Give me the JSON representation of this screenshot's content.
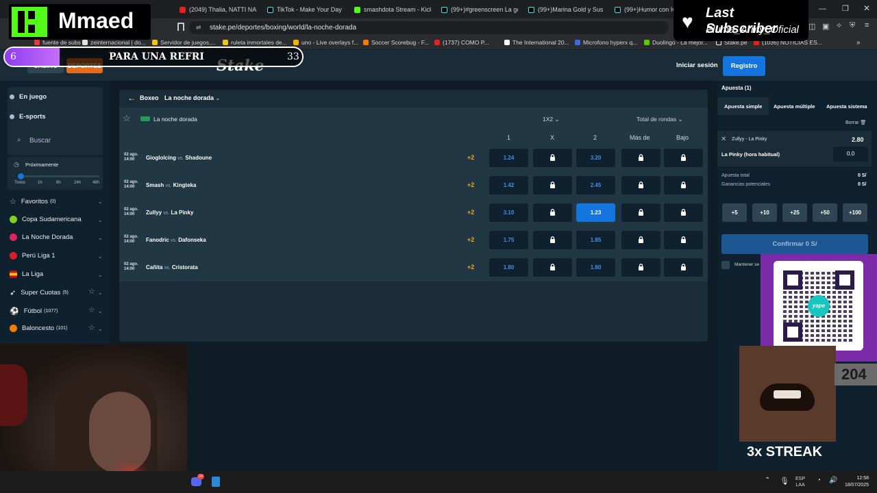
{
  "browser": {
    "tabs": [
      {
        "title": "(2049) Thalia, NATTI NATA",
        "color": "#e62117"
      },
      {
        "title": "TikTok - Make Your Day",
        "color": "#111111"
      },
      {
        "title": "smashdota Stream - Kick",
        "color": "#53fc18"
      },
      {
        "title": "(99+)#greenscreen La gen",
        "color": "#111111"
      },
      {
        "title": "(99+)Marina Gold y Sus H",
        "color": "#111111"
      },
      {
        "title": "(99+)Humor con Ivan",
        "color": "#111111"
      }
    ],
    "url": "stake.pe/deportes/boxing/world/la-noche-dorada",
    "bookmarks": [
      {
        "label": "fuente de subs",
        "color": "#e23b3b"
      },
      {
        "label": "zeinternacional | do...",
        "color": "#e2e2e2"
      },
      {
        "label": "Servidor de juegos,...",
        "color": "#bbbbbb"
      },
      {
        "label": "ruleta inmortales de...",
        "color": "#f5b400"
      },
      {
        "label": "uno - Live overlays f...",
        "color": "#f5b400"
      },
      {
        "label": "Soccer Scorebug - F...",
        "color": "#f57c00"
      },
      {
        "label": "(1737) COMO P...",
        "color": "#e62117"
      },
      {
        "label": "The International 20...",
        "color": "#ffffff"
      },
      {
        "label": "Microfono hyperx q...",
        "color": "#3b6edc"
      },
      {
        "label": "Duolingo - La mejor...",
        "color": "#58cc02"
      },
      {
        "label": "Stake.pe",
        "color": "#1a2c38"
      },
      {
        "label": "(1036) NOTICIAS ES...",
        "color": "#e62117"
      }
    ]
  },
  "overlay": {
    "channel_name": "Mmaed",
    "goal_count": "6",
    "goal_text": "PARA UNA REFRI",
    "goal_target": "33",
    "last_subscriber_title": "Last Subscriber",
    "last_subscriber_name": "Pluma_Army_Oficial",
    "qr_label": "yape",
    "streak_count": "204",
    "streak_label": "3x STREAK"
  },
  "stake": {
    "nav_casino": "CASINO",
    "nav_sports": "DEPORTES",
    "logo": "Stake",
    "login": "Iniciar sesión",
    "register": "Registro",
    "sidebar": {
      "live": "En juego",
      "esports": "E-sports",
      "search_placeholder": "Buscar",
      "upcoming": "Próximamente",
      "time_filters": [
        "Todos",
        "1h",
        "8h",
        "24h",
        "48h"
      ],
      "items": [
        {
          "label": "Favoritos",
          "count": "(0)",
          "color": "#7f94a3",
          "star": false
        },
        {
          "label": "Copa Sudamericana",
          "count": "",
          "color": "#7ed321",
          "star": false
        },
        {
          "label": "La Noche Dorada",
          "count": "",
          "color": "#e0245e",
          "star": false
        },
        {
          "label": "Perú Liga 1",
          "count": "",
          "color": "#d91e2a",
          "star": false
        },
        {
          "label": "La Liga",
          "count": "",
          "color": "#f6c000",
          "star": false
        },
        {
          "label": "Super Cuotas",
          "count": "(5)",
          "color": "#ffffff",
          "star": true
        },
        {
          "label": "Fútbol",
          "count": "(1077)",
          "color": "#ffffff",
          "star": true
        },
        {
          "label": "Baloncesto",
          "count": "(101)",
          "color": "#f57c00",
          "star": true
        }
      ]
    },
    "breadcrumb": {
      "sport": "Boxeo",
      "event": "La noche dorada"
    },
    "event_title": "La noche dorada",
    "market_selector": "1X2",
    "rounds_selector": "Total de rondas",
    "columns": [
      "1",
      "X",
      "2",
      "Más de",
      "Bajo"
    ],
    "matches": [
      {
        "date": "02 ago.",
        "time": "14:00",
        "home": "Gioglolcing",
        "away": "Shadoune",
        "more": "+2",
        "odd1": "1.24",
        "odd2": "3.20",
        "selected": false
      },
      {
        "date": "02 ago.",
        "time": "14:00",
        "home": "Smash",
        "away": "Kingteka",
        "more": "+2",
        "odd1": "1.42",
        "odd2": "2.45",
        "selected": false
      },
      {
        "date": "02 ago.",
        "time": "14:00",
        "home": "Zullyy",
        "away": "La Pinky",
        "more": "+2",
        "odd1": "3.10",
        "odd2": "1.23",
        "selected": true
      },
      {
        "date": "02 ago.",
        "time": "14:00",
        "home": "Fanodric",
        "away": "Dafonseka",
        "more": "+2",
        "odd1": "1.75",
        "odd2": "1.85",
        "selected": false
      },
      {
        "date": "02 ago.",
        "time": "14:00",
        "home": "Cañita",
        "away": "Cristorata",
        "more": "+2",
        "odd1": "1.80",
        "odd2": "1.80",
        "selected": false
      }
    ],
    "vs": "vs.",
    "betslip": {
      "title": "Apuesta (1)",
      "tabs": [
        "Apuesta simple",
        "Apuesta múltiple",
        "Apuesta sistema"
      ],
      "clear": "Borrar",
      "event": "Zullyy - La Pinky",
      "odd": "2.80",
      "selection": "La Pinky (hora habitual)",
      "stake_value": "0.0",
      "total_label": "Apuesta total",
      "total_value": "0 S/",
      "potential_label": "Ganancias potenciales",
      "potential_value": "0 S/",
      "chips": [
        "+5",
        "+10",
        "+25",
        "+50",
        "+100"
      ],
      "confirm": "Confirmar 0 S/",
      "keep": "Mantener se"
    }
  },
  "taskbar": {
    "lang": "ESP",
    "lang2": "LAA",
    "time": "12:58",
    "date": "18/07/2025",
    "discord_badge": "24"
  }
}
